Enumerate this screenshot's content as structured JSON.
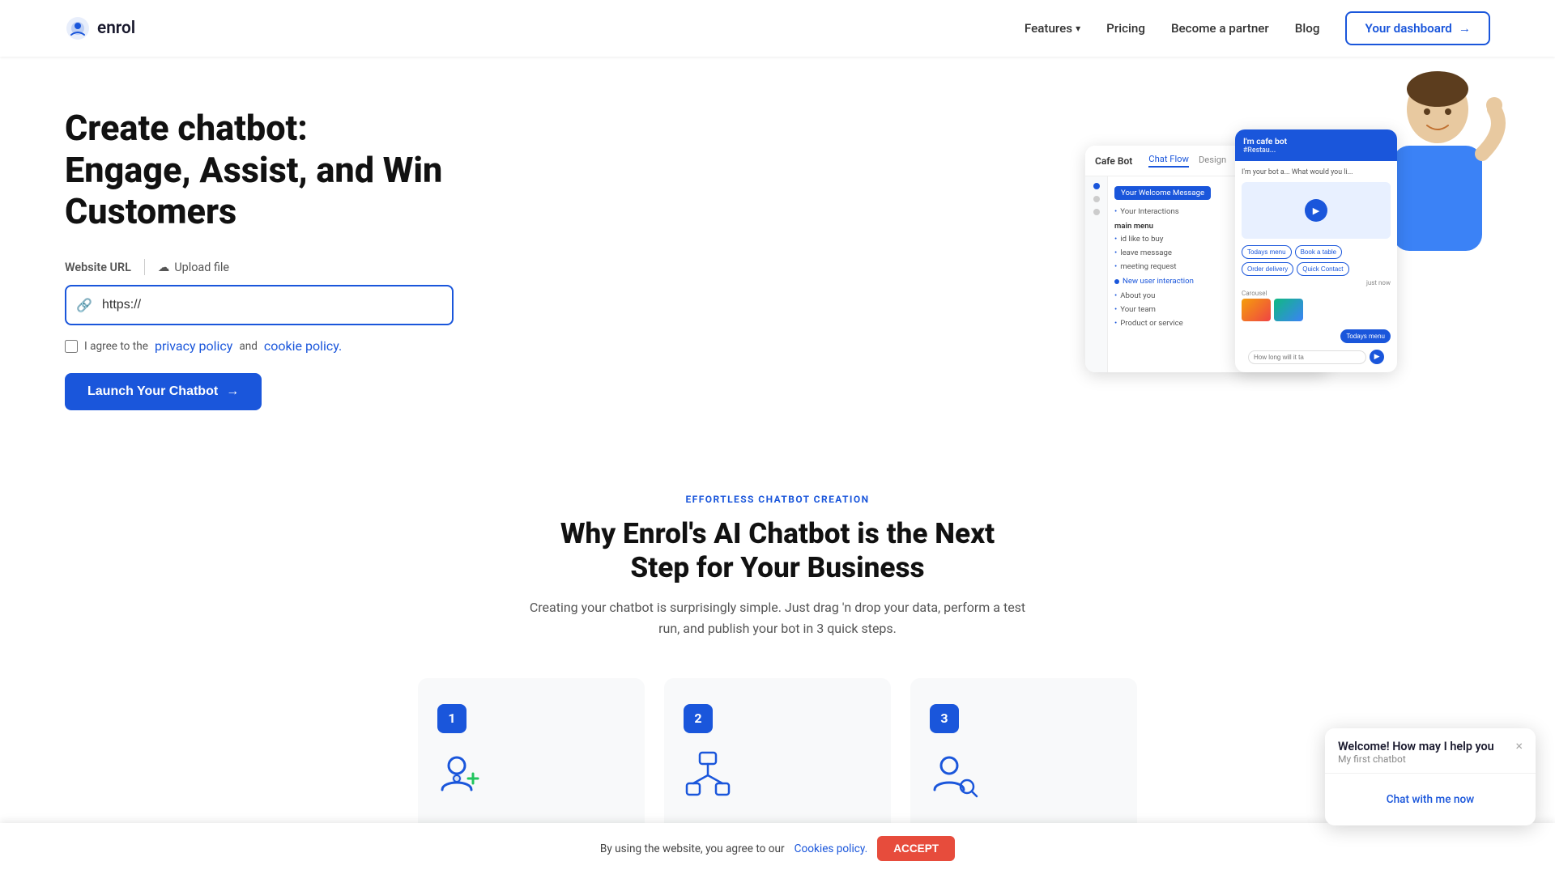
{
  "nav": {
    "logo_text": "enrol",
    "links": [
      {
        "id": "features",
        "label": "Features",
        "has_dropdown": true
      },
      {
        "id": "pricing",
        "label": "Pricing"
      },
      {
        "id": "partner",
        "label": "Become a partner"
      },
      {
        "id": "blog",
        "label": "Blog"
      }
    ],
    "dashboard_btn": "Your dashboard"
  },
  "hero": {
    "title_line1": "Create chatbot:",
    "title_line2": "Engage, Assist, and Win",
    "title_line3": "Customers",
    "url_label": "Website URL",
    "upload_label": "Upload file",
    "url_placeholder": "https://",
    "url_value": "https://",
    "terms_text": "I agree to the",
    "privacy_label": "privacy policy",
    "and_text": "and",
    "cookie_label": "cookie policy.",
    "launch_btn": "Launch Your Chatbot"
  },
  "chatbot_mockup": {
    "bot_name": "Cafe Bot",
    "tab1": "Chat Flow",
    "tab2": "Design",
    "welcome_msg": "Your Welcome Message",
    "interactions_label": "Your Interactions",
    "main_menu": "main menu",
    "id_like_to_buy": "id like to buy",
    "leave_message": "leave message",
    "meeting_request": "meeting request",
    "new_interaction": "New user interaction",
    "about_you": "About you",
    "your_team": "Your team",
    "product_service": "Product or service",
    "preview_title": "I'm cafe bot",
    "preview_sub1": "I'm your bot a...",
    "preview_sub2": "What would you li...",
    "just_now": "just now",
    "quick1": "Todays menu",
    "quick2": "Book a table",
    "quick3": "Order delivery",
    "quick4": "Quick Contact",
    "carousel_label": "Carousel",
    "todays_menu_btn": "Todays menu",
    "input_placeholder": "How long will it ta",
    "interaction_label": "#Restau..."
  },
  "section_why": {
    "badge": "EFFORTLESS CHATBOT CREATION",
    "title_line1": "Why Enrol's AI Chatbot is the Next",
    "title_line2": "Step for Your Business",
    "description": "Creating your chatbot is surprisingly simple. Just drag 'n drop your data, perform a test run, and publish your bot in 3 quick steps.",
    "steps": [
      {
        "num": "1",
        "icon": "user-add"
      },
      {
        "num": "2",
        "icon": "network"
      },
      {
        "num": "3",
        "icon": "user-search"
      }
    ]
  },
  "cookie_banner": {
    "text": "By using the website, you agree to our",
    "link_label": "Cookies policy.",
    "accept_label": "ACCEPT"
  },
  "chat_widget": {
    "title": "Welcome! How may I help you",
    "subtitle": "My first chatbot",
    "chat_link": "Chat with me now",
    "close_icon": "×"
  }
}
